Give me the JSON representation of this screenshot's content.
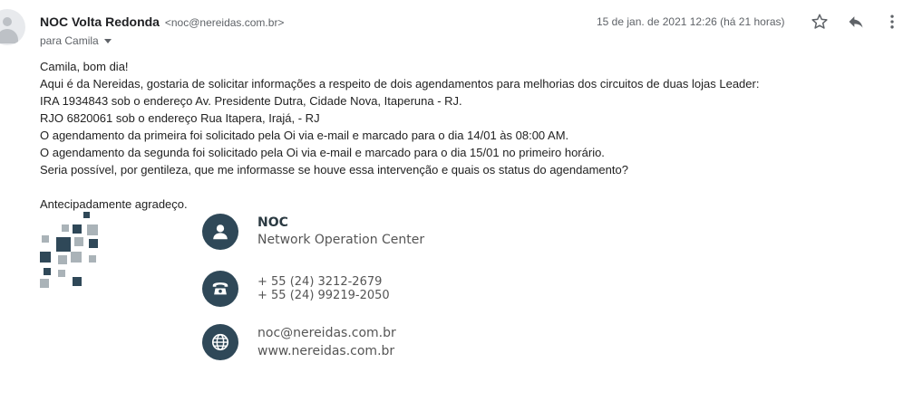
{
  "header": {
    "sender_name": "NOC Volta Redonda",
    "sender_email": "<noc@nereidas.com.br>",
    "to_label": "para Camila",
    "date": "15 de jan. de 2021 12:26 (há 21 horas)"
  },
  "actions": {
    "star_icon": "star-outline",
    "reply_icon": "reply-arrow",
    "more_icon": "vertical-dots"
  },
  "body": {
    "lines": [
      "Camila, bom dia!",
      "Aqui é da Nereidas, gostaria de solicitar informações a respeito de dois agendamentos para melhorias dos circuitos de duas lojas Leader:",
      "IRA 1934843 sob o endereço Av. Presidente Dutra, Cidade Nova, Itaperuna - RJ.",
      "RJO 6820061 sob o endereço Rua Itapera, Irajá, - RJ",
      "O agendamento da primeira foi solicitado pela Oi via e-mail e marcado para o dia 14/01 às 08:00 AM.",
      "O agendamento da segunda foi solicitado pela Oi via e-mail e marcado para o dia 15/01 no primeiro horário.",
      "Seria possível, por gentileza, que me informasse se houve essa intervenção e quais os status do agendamento?"
    ],
    "closing": "Antecipadamente agradeço."
  },
  "signature": {
    "title": "NOC",
    "subtitle": "Network Operation Center",
    "phone1": "+ 55 (24) 3212-2679",
    "phone2": "+ 55 (24) 99219-2050",
    "email": "noc@nereidas.com.br",
    "website": "www.nereidas.com.br",
    "icons": [
      "person-icon",
      "phone-icon",
      "globe-icon"
    ],
    "circle_color": "#2f4858"
  }
}
